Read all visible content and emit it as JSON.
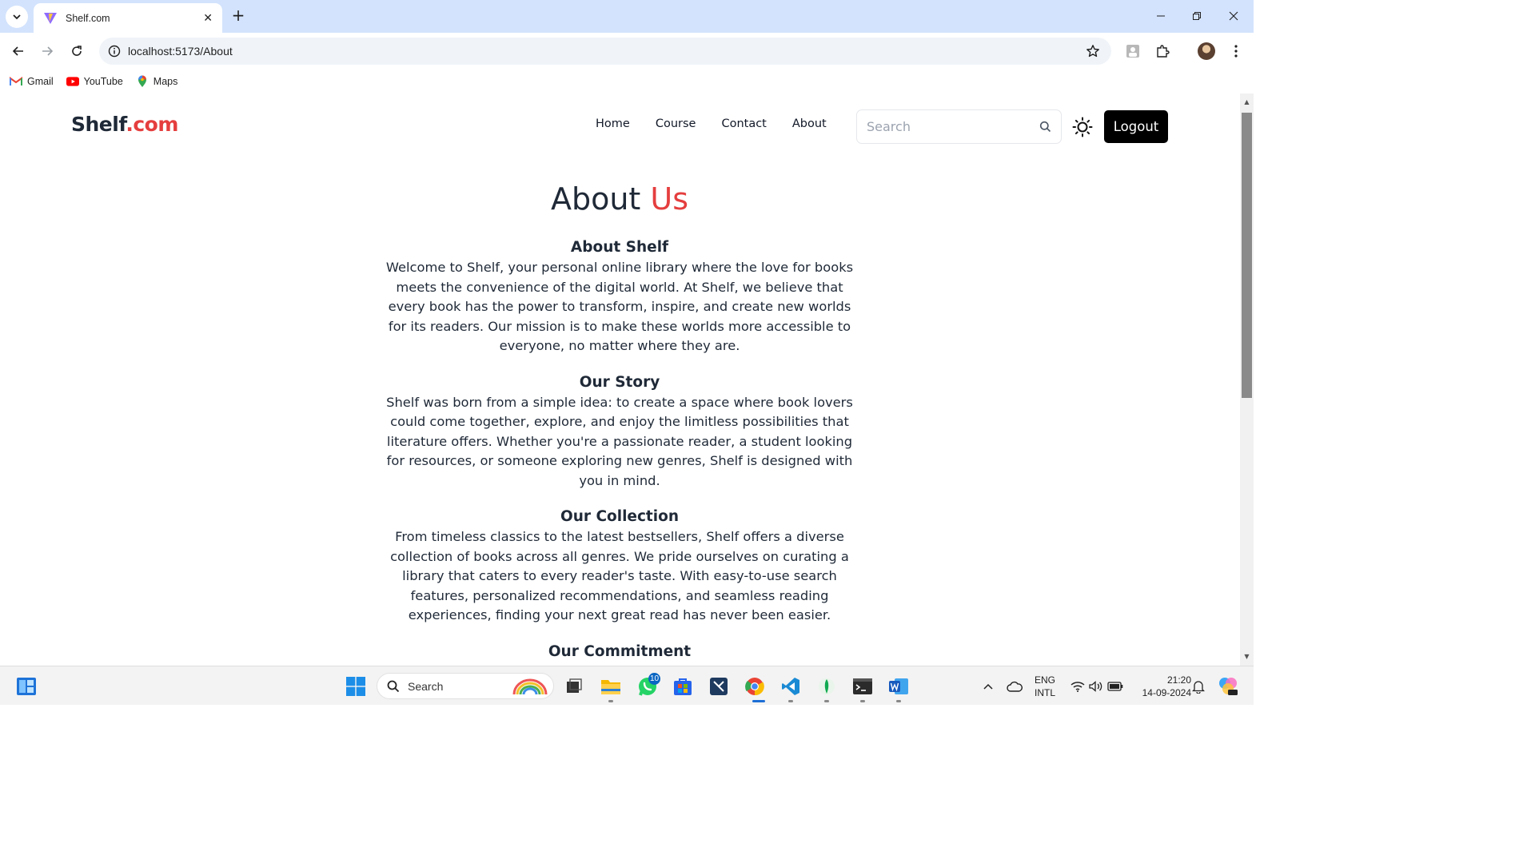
{
  "browser": {
    "tab_title": "Shelf.com",
    "url": "localhost:5173/About",
    "bookmarks": [
      {
        "label": "Gmail",
        "icon": "gmail-icon"
      },
      {
        "label": "YouTube",
        "icon": "youtube-icon"
      },
      {
        "label": "Maps",
        "icon": "maps-icon"
      }
    ]
  },
  "site": {
    "logo_main": "Shelf",
    "logo_accent": ".com",
    "nav": [
      "Home",
      "Course",
      "Contact",
      "About"
    ],
    "search_placeholder": "Search",
    "logout_label": "Logout",
    "accent_color": "#e53e3e"
  },
  "page": {
    "heading_main": "About ",
    "heading_accent": "Us",
    "sections": [
      {
        "title": "About Shelf",
        "body": "Welcome to Shelf, your personal online library where the love for books meets the convenience of the digital world. At Shelf, we believe that every book has the power to transform, inspire, and create new worlds for its readers. Our mission is to make these worlds more accessible to everyone, no matter where they are."
      },
      {
        "title": "Our Story",
        "body": "Shelf was born from a simple idea: to create a space where book lovers could come together, explore, and enjoy the limitless possibilities that literature offers. Whether you're a passionate reader, a student looking for resources, or someone exploring new genres, Shelf is designed with you in mind."
      },
      {
        "title": "Our Collection",
        "body": "From timeless classics to the latest bestsellers, Shelf offers a diverse collection of books across all genres. We pride ourselves on curating a library that caters to every reader's taste. With easy-to-use search features, personalized recommendations, and seamless reading experiences, finding your next great read has never been easier."
      },
      {
        "title": "Our Commitment",
        "body": ""
      }
    ]
  },
  "taskbar": {
    "search_label": "Search",
    "whatsapp_badge": "10",
    "lang_line1": "ENG",
    "lang_line2": "INTL",
    "time": "21:20",
    "date": "14-09-2024"
  }
}
